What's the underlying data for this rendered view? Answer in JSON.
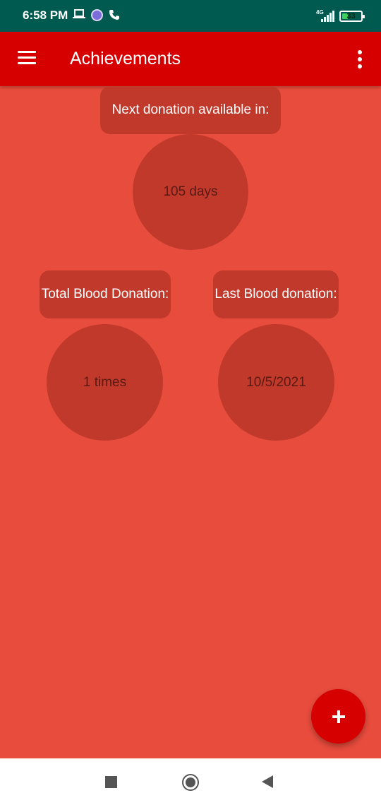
{
  "status_bar": {
    "time": "6:58 PM",
    "network": "4G",
    "battery_level": "33",
    "battery_fraction": 0.33,
    "icons": [
      "laptop-icon",
      "viber-icon",
      "phone-icon",
      "signal-icon",
      "battery-icon"
    ]
  },
  "app_bar": {
    "title": "Achievements",
    "menu_icon": "menu-icon",
    "overflow_icon": "more-vert-icon"
  },
  "next_donation": {
    "label": "Next donation available in:",
    "value": "105 days"
  },
  "total_donation": {
    "label": "Total Blood Donation:",
    "value": "1 times"
  },
  "last_donation": {
    "label": "Last Blood donation:",
    "value": "10/5/2021"
  },
  "fab": {
    "icon": "plus-icon"
  },
  "nav_bar": {
    "icons": [
      "recents-icon",
      "home-icon",
      "back-icon"
    ]
  },
  "colors": {
    "status_bar": "#005a4f",
    "app_bar": "#d60000",
    "background": "#e84c3d",
    "card": "#c0392b",
    "value_text": "#5a1a14"
  }
}
